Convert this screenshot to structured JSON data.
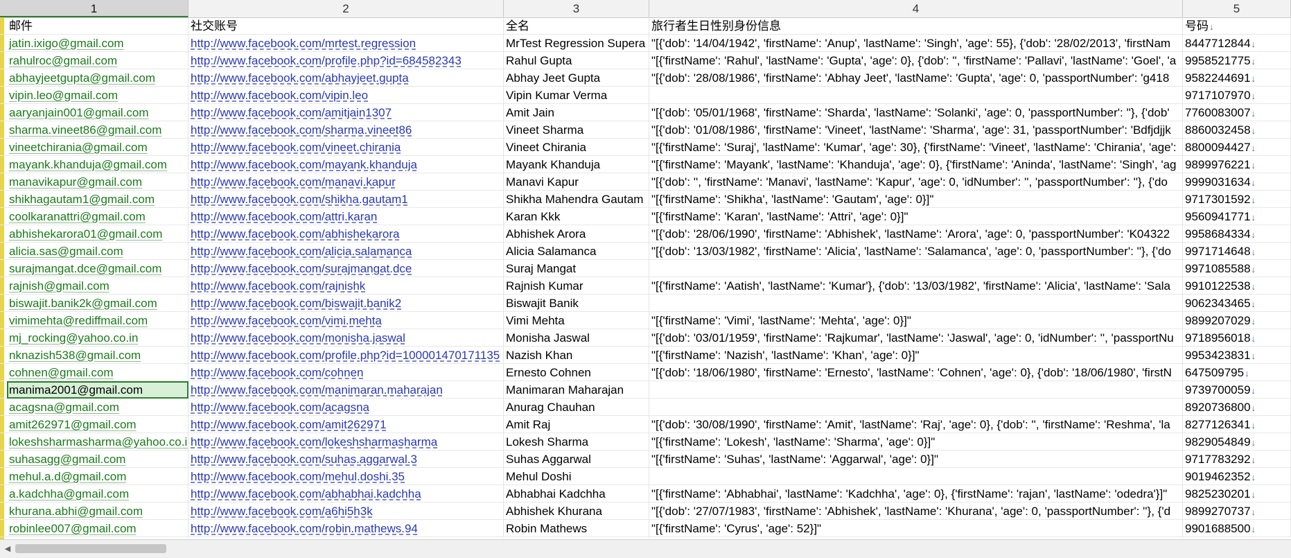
{
  "column_headers": [
    "1",
    "2",
    "3",
    "4",
    "5"
  ],
  "active_column": "1",
  "header_row": {
    "email": "邮件",
    "social": "社交账号",
    "name": "全名",
    "traveler": "旅行者生日性别身份信息",
    "phone": "号码",
    "phone_arrow": "↓"
  },
  "rows": [
    {
      "email": "jatin.ixigo@gmail.com",
      "social": "http://www.facebook.com/mrtest.regression",
      "name": "MrTest Regression Supera",
      "traveler": "\"[{'dob': '14/04/1942', 'firstName': 'Anup', 'lastName': 'Singh', 'age': 55}, {'dob': '28/02/2013', 'firstNam",
      "phone": "8447712844"
    },
    {
      "email": "rahulroc@gmail.com",
      "social": "http://www.facebook.com/profile.php?id=684582343",
      "name": "Rahul Gupta",
      "traveler": "\"[{'firstName': 'Rahul', 'lastName': 'Gupta', 'age': 0}, {'dob': '', 'firstName': 'Pallavi', 'lastName': 'Goel', 'a",
      "phone": "9958521775"
    },
    {
      "email": "abhayjeetgupta@gmail.com",
      "social": "http://www.facebook.com/abhayjeet.gupta",
      "name": "Abhay Jeet Gupta",
      "traveler": "\"[{'dob': '28/08/1986', 'firstName': 'Abhay Jeet', 'lastName': 'Gupta', 'age': 0, 'passportNumber': 'g418",
      "phone": "9582244691"
    },
    {
      "email": "vipin.leo@gmail.com",
      "social": "http://www.facebook.com/vipin.leo",
      "name": "Vipin Kumar Verma",
      "traveler": "",
      "phone": "9717107970"
    },
    {
      "email": "aaryanjain001@gmail.com",
      "social": "http://www.facebook.com/amitjain1307",
      "name": "Amit Jain",
      "traveler": "\"[{'dob': '05/01/1968', 'firstName': 'Sharda', 'lastName': 'Solanki', 'age': 0, 'passportNumber': ''}, {'dob'",
      "phone": "7760083007"
    },
    {
      "email": "sharma.vineet86@gmail.com",
      "social": "http://www.facebook.com/sharma.vineet86",
      "name": "Vineet Sharma",
      "traveler": "\"[{'dob': '01/08/1986', 'firstName': 'Vineet', 'lastName': 'Sharma', 'age': 31, 'passportNumber': 'Bdfjdjjk",
      "phone": "8860032458"
    },
    {
      "email": "vineetchirania@gmail.com",
      "social": "http://www.facebook.com/vineet.chirania",
      "name": "Vineet Chirania",
      "traveler": "\"[{'firstName': 'Suraj', 'lastName': 'Kumar', 'age': 30}, {'firstName': 'Vineet', 'lastName': 'Chirania', 'age':",
      "phone": "8800094427"
    },
    {
      "email": "mayank.khanduja@gmail.com",
      "social": "http://www.facebook.com/mayank.khanduja",
      "name": "Mayank Khanduja",
      "traveler": "\"[{'firstName': 'Mayank', 'lastName': 'Khanduja', 'age': 0}, {'firstName': 'Aninda', 'lastName': 'Singh', 'ag",
      "phone": "9899976221"
    },
    {
      "email": "manavikapur@gmail.com",
      "social": "http://www.facebook.com/manavi.kapur",
      "name": "Manavi Kapur",
      "traveler": "\"[{'dob': '', 'firstName': 'Manavi', 'lastName': 'Kapur', 'age': 0, 'idNumber': '', 'passportNumber': ''}, {'do",
      "phone": "9999031634"
    },
    {
      "email": "shikhagautam1@gmail.com",
      "social": "http://www.facebook.com/shikha.gautam1",
      "name": "Shikha Mahendra Gautam",
      "traveler": "\"[{'firstName': 'Shikha', 'lastName': 'Gautam', 'age': 0}]\"",
      "phone": "9717301592"
    },
    {
      "email": "coolkaranattri@gmail.com",
      "social": "http://www.facebook.com/attri.karan",
      "name": "Karan Kkk",
      "traveler": "\"[{'firstName': 'Karan', 'lastName': 'Attri', 'age': 0}]\"",
      "phone": "9560941771"
    },
    {
      "email": "abhishekarora01@gmail.com",
      "social": "http://www.facebook.com/abhishekarora",
      "name": "Abhishek Arora",
      "traveler": "\"[{'dob': '28/06/1990', 'firstName': 'Abhishek', 'lastName': 'Arora', 'age': 0, 'passportNumber': 'K04322",
      "phone": "9958684334"
    },
    {
      "email": "alicia.sas@gmail.com",
      "social": "http://www.facebook.com/alicia.salamanca",
      "name": "Alicia Salamanca",
      "traveler": "\"[{'dob': '13/03/1982', 'firstName': 'Alicia', 'lastName': 'Salamanca', 'age': 0, 'passportNumber': ''}, {'do",
      "phone": "9971714648"
    },
    {
      "email": "surajmangat.dce@gmail.com",
      "social": "http://www.facebook.com/surajmangat.dce",
      "name": "Suraj Mangat",
      "traveler": "",
      "phone": "9971085588"
    },
    {
      "email": "rajnish@gmail.com",
      "social": "http://www.facebook.com/rajnishk",
      "name": "Rajnish Kumar",
      "traveler": "\"[{'firstName': 'Aatish', 'lastName': 'Kumar'}, {'dob': '13/03/1982', 'firstName': 'Alicia', 'lastName': 'Sala",
      "phone": "9910122538"
    },
    {
      "email": "biswajit.banik2k@gmail.com",
      "social": "http://www.facebook.com/biswajit.banik2",
      "name": "Biswajit Banik",
      "traveler": "",
      "phone": "9062343465"
    },
    {
      "email": "vimimehta@rediffmail.com",
      "social": "http://www.facebook.com/vimi.mehta",
      "name": "Vimi Mehta",
      "traveler": "\"[{'firstName': 'Vimi', 'lastName': 'Mehta', 'age': 0}]\"",
      "phone": "9899207029"
    },
    {
      "email": "mj_rocking@yahoo.co.in",
      "social": "http://www.facebook.com/monisha.jaswal",
      "name": "Monisha Jaswal",
      "traveler": "\"[{'dob': '03/01/1959', 'firstName': 'Rajkumar', 'lastName': 'Jaswal', 'age': 0, 'idNumber': '', 'passportNu",
      "phone": "9718956018"
    },
    {
      "email": "nknazish538@gmail.com",
      "social": "http://www.facebook.com/profile.php?id=100001470171135",
      "name": "Nazish Khan",
      "traveler": "\"[{'firstName': 'Nazish', 'lastName': 'Khan', 'age': 0}]\"",
      "phone": "9953423831"
    },
    {
      "email": "cohnen@gmail.com",
      "social": "http://www.facebook.com/cohnen",
      "name": "Ernesto Cohnen",
      "traveler": "\"[{'dob': '18/06/1980', 'firstName': 'Ernesto', 'lastName': 'Cohnen', 'age': 0}, {'dob': '18/06/1980', 'firstN",
      "phone": "647509795"
    },
    {
      "email": "manima2001@gmail.com",
      "social": "http://www.facebook.com/manimaran.maharajan",
      "name": "Manimaran Maharajan",
      "traveler": "",
      "phone": "9739700059"
    },
    {
      "email": "acagsna@gmail.com",
      "social": "http://www.facebook.com/acagsna",
      "name": "Anurag Chauhan",
      "traveler": "",
      "phone": "8920736800"
    },
    {
      "email": "amit262971@gmail.com",
      "social": "http://www.facebook.com/amit262971",
      "name": "Amit Raj",
      "traveler": "\"[{'dob': '30/08/1990', 'firstName': 'Amit', 'lastName': 'Raj', 'age': 0}, {'dob': '', 'firstName': 'Reshma', 'la",
      "phone": "8277126341"
    },
    {
      "email": "lokeshsharmasharma@yahoo.co.in",
      "social": "http://www.facebook.com/lokeshsharmasharma",
      "name": "Lokesh Sharma",
      "traveler": "\"[{'firstName': 'Lokesh', 'lastName': 'Sharma', 'age': 0}]\"",
      "phone": "9829054849"
    },
    {
      "email": "suhasagg@gmail.com",
      "social": "http://www.facebook.com/suhas.aggarwal.3",
      "name": "Suhas Aggarwal",
      "traveler": "\"[{'firstName': 'Suhas', 'lastName': 'Aggarwal', 'age': 0}]\"",
      "phone": "9717783292"
    },
    {
      "email": "mehul.a.d@gmail.com",
      "social": "http://www.facebook.com/mehul.doshi.35",
      "name": "Mehul Doshi",
      "traveler": "",
      "phone": "9019462352"
    },
    {
      "email": "a.kadchha@gmail.com",
      "social": "http://www.facebook.com/abhabhai.kadchha",
      "name": "Abhabhai Kadchha",
      "traveler": "\"[{'firstName': 'Abhabhai', 'lastName': 'Kadchha', 'age': 0}, {'firstName': 'rajan', 'lastName': 'odedra'}]\"",
      "phone": "9825230201"
    },
    {
      "email": "khurana.abhi@gmail.com",
      "social": "http://www.facebook.com/a6hi5h3k",
      "name": "Abhishek Khurana",
      "traveler": "\"[{'dob': '27/07/1983', 'firstName': 'Abhishek', 'lastName': 'Khurana', 'age': 0, 'passportNumber': ''}, {'d",
      "phone": "9899270737"
    },
    {
      "email": "robinlee007@gmail.com",
      "social": "http://www.facebook.com/robin.mathews.94",
      "name": "Robin Mathews",
      "traveler": "\"[{'firstName': 'Cyrus', 'age': 52}]\"",
      "phone": "9901688500"
    }
  ],
  "selected_row": 20,
  "colors": {
    "email_text": "#1a7a1a",
    "link_text": "#2838b8",
    "selection_border": "#2e7d32",
    "selection_fill": "#d7f0d7",
    "row_indicator": "#e8d44a"
  },
  "icons": {
    "phone_arrow": "down-arrow-icon",
    "scroll_left": "chevron-left-icon"
  }
}
